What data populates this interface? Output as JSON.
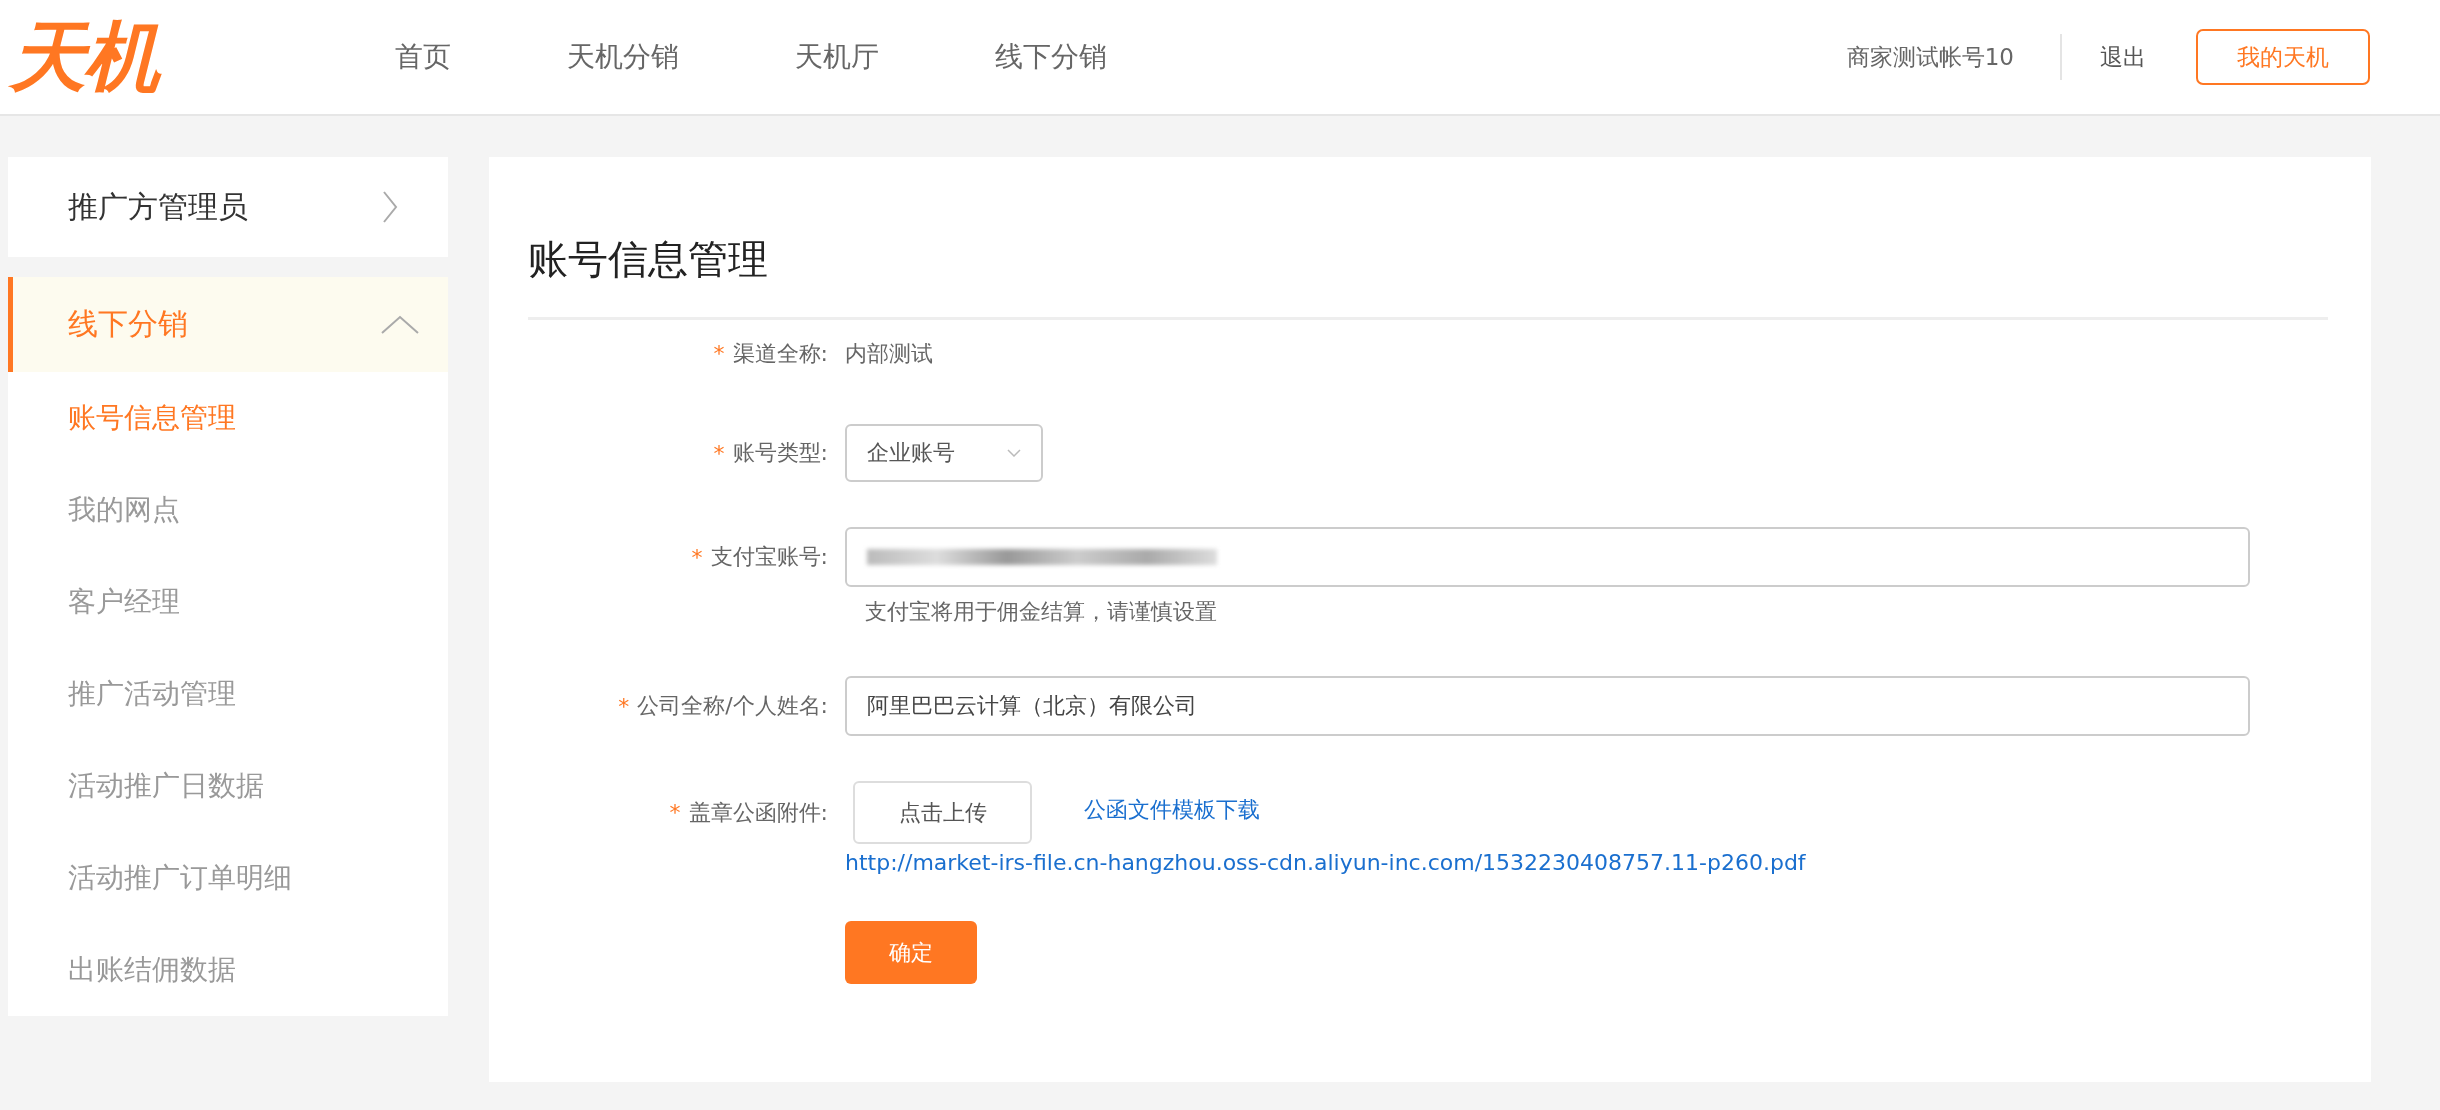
{
  "header": {
    "logo": "天机",
    "nav": [
      {
        "label": "首页",
        "selected": false
      },
      {
        "label": "天机分销",
        "selected": false
      },
      {
        "label": "天机厅",
        "selected": false
      },
      {
        "label": "线下分销",
        "selected": false
      }
    ],
    "user": "商家测试帐号10",
    "logout": "退出",
    "my_button": "我的天机"
  },
  "sidebar": [
    {
      "label": "推广方管理员",
      "expanded": false
    },
    {
      "label": "线下分销",
      "expanded": true,
      "items": [
        {
          "label": "账号信息管理",
          "selected": true
        },
        {
          "label": "我的网点",
          "selected": false
        },
        {
          "label": "客户经理",
          "selected": false
        },
        {
          "label": "推广活动管理",
          "selected": false
        },
        {
          "label": "活动推广日数据",
          "selected": false
        },
        {
          "label": "活动推广订单明细",
          "selected": false
        },
        {
          "label": "出账结佣数据",
          "selected": false
        }
      ]
    }
  ],
  "page": {
    "title": "账号信息管理",
    "form": [
      {
        "kind": "static",
        "label": "渠道全称:",
        "required_mark": "*",
        "value": "内部测试"
      },
      {
        "kind": "select",
        "label": "账号类型:",
        "required_mark": "*",
        "value": "企业账号"
      },
      {
        "kind": "masked",
        "label": "支付宝账号:",
        "required_mark": "*",
        "hint": "支付宝将用于佣金结算，请谨慎设置"
      },
      {
        "kind": "input",
        "label": "公司全称/个人姓名:",
        "required_mark": "*",
        "value": "阿里巴巴云计算（北京）有限公司"
      },
      {
        "kind": "upload",
        "label": "盖章公函附件:",
        "required_mark": "*",
        "button": "点击上传",
        "link": "公函文件模板下载",
        "file_url": "http://market-irs-file.cn-hangzhou.oss-cdn.aliyun-inc.com/1532230408757.11-p260.pdf"
      }
    ],
    "submit": "确定"
  }
}
